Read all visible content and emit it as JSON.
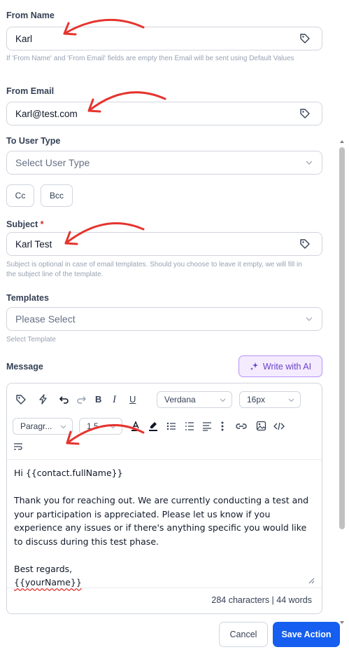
{
  "from_name": {
    "label": "From Name",
    "value": "Karl",
    "help": "If 'From Name' and 'From Email' fields are empty then Email will be sent using Default Values"
  },
  "from_email": {
    "label": "From Email",
    "value": "Karl@test.com"
  },
  "to_user_type": {
    "label": "To User Type",
    "placeholder": "Select User Type"
  },
  "cc_label": "Cc",
  "bcc_label": "Bcc",
  "subject": {
    "label": "Subject",
    "required_mark": "*",
    "value": "Karl Test",
    "help": "Subject is optional in case of email templates. Should you choose to leave it empty, we will fill in the subject line of the template."
  },
  "templates": {
    "label": "Templates",
    "placeholder": "Please Select",
    "help": "Select Template"
  },
  "message": {
    "label": "Message",
    "ai_button": "Write with AI",
    "toolbar": {
      "font": "Verdana",
      "size": "16px",
      "paragraph": "Paragr...",
      "line_height": "1.5"
    },
    "lines": [
      "Hi {{contact.fullName}}",
      "",
      "Thank you for reaching out. We are currently conducting a test and",
      "your participation is appreciated. Please let us know if you",
      "experience any issues or if there's anything specific you would like",
      "to discuss during this test phase.",
      "",
      "Best regards,",
      "{{yourName}}"
    ],
    "counter": "284 characters | 44 words"
  },
  "actions": {
    "cancel": "Cancel",
    "save": "Save Action"
  },
  "colors": {
    "accent": "#155eef",
    "ai": "#6941c6",
    "arrow": "#e5342f"
  }
}
